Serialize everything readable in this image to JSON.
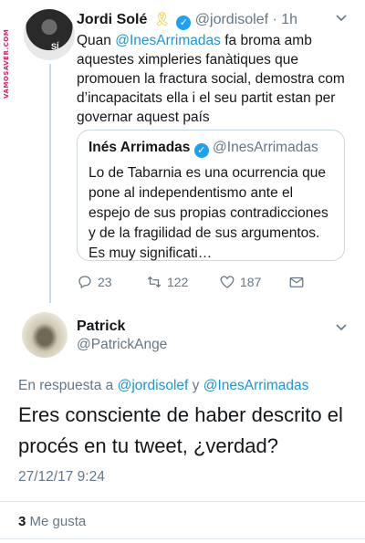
{
  "watermark": "VAMOSAVER.COM",
  "tweet1": {
    "author_name": "Jordi Solé",
    "author_handle": "@jordisolef",
    "time": "· 1h",
    "text_parts": [
      "Quan ",
      "@InesArrimadas",
      " fa broma amb aquestes ximpleries fanàtiques que promouen la fractura social, demostra com d’incapacitats ella i el seu partit estan per governar aquest país"
    ],
    "quote": {
      "author_name": "Inés Arrimadas",
      "author_handle": "@InesArrimadas",
      "text": "Lo de Tabarnia es una ocurrencia que pone al independentismo ante el espejo de sus propias contradicciones y de la fragilidad de sus argumentos. Es muy significati…"
    },
    "actions": {
      "replies": "23",
      "retweets": "122",
      "likes": "187"
    }
  },
  "tweet2": {
    "author_name": "Patrick",
    "author_handle": "@PatrickAnge",
    "reply_prefix": "En respuesta a ",
    "reply_user1": "@jordisolef",
    "reply_and": " y ",
    "reply_user2": "@InesArrimadas",
    "text": "Eres consciente de haber descrito el procés en tu tweet, ¿verdad?",
    "date": "27/12/17 9:24",
    "likes_count": "3",
    "likes_label": " Me gusta"
  },
  "colors": {
    "link": "#1b95e0",
    "muted": "#657786",
    "verified": "#1da1f2"
  }
}
